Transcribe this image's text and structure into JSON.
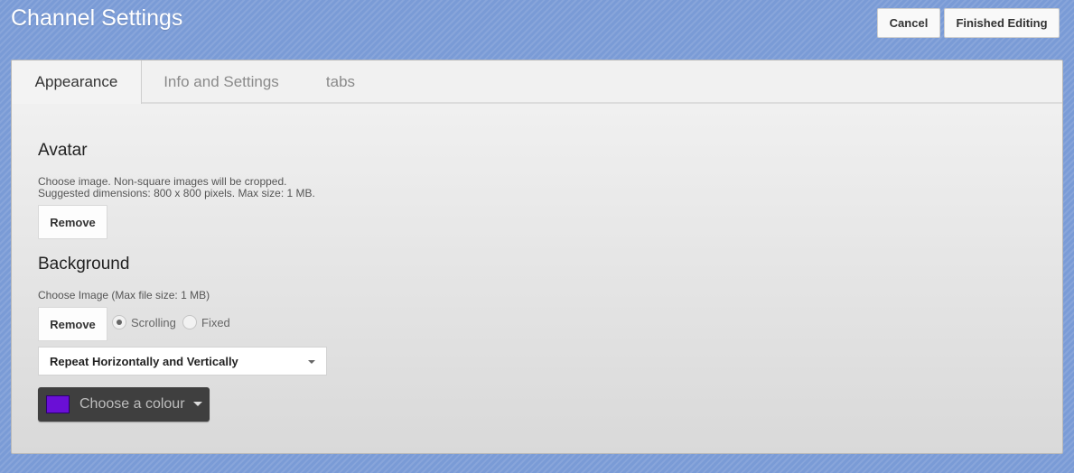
{
  "header": {
    "title": "Channel Settings",
    "cancel_label": "Cancel",
    "finish_label": "Finished Editing"
  },
  "tabs": [
    {
      "label": "Appearance",
      "active": true
    },
    {
      "label": "Info and Settings",
      "active": false
    },
    {
      "label": "tabs",
      "active": false
    }
  ],
  "avatar": {
    "title": "Avatar",
    "help_line1": "Choose image. Non-square images will be cropped.",
    "help_line2": "Suggested dimensions: 800 x 800 pixels. Max size: 1 MB.",
    "remove_label": "Remove"
  },
  "background": {
    "title": "Background",
    "help": "Choose Image (Max file size: 1 MB)",
    "remove_label": "Remove",
    "scroll_options": [
      {
        "label": "Scrolling",
        "checked": true
      },
      {
        "label": "Fixed",
        "checked": false
      }
    ],
    "repeat_selected": "Repeat Horizontally and Vertically",
    "colour_label": "Choose a colour",
    "colour_value": "#6a0fd6"
  },
  "colors": {
    "page_background": "#7a9bd6",
    "picker_background": "#3f3f3f"
  }
}
